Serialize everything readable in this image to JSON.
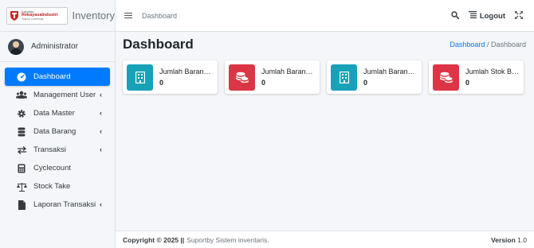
{
  "brand": {
    "line1": "Fakultas",
    "line2": "RekayasaIndustri",
    "line3": "Telkom University",
    "text": "Inventory"
  },
  "user": {
    "name": "Administrator"
  },
  "sidebar": {
    "items": [
      {
        "label": "Dashboard",
        "icon": "dashboard-icon"
      },
      {
        "label": "Management User",
        "icon": "users-icon"
      },
      {
        "label": "Data Master",
        "icon": "gear-icon"
      },
      {
        "label": "Data Barang",
        "icon": "database-icon"
      },
      {
        "label": "Transaksi",
        "icon": "exchange-icon"
      },
      {
        "label": "Cyclecount",
        "icon": "calculator-icon"
      },
      {
        "label": "Stock Take",
        "icon": "balance-icon"
      },
      {
        "label": "Laporan Transaksi",
        "icon": "file-icon"
      }
    ]
  },
  "topbar": {
    "title": "Dashboard",
    "logout": "Logout"
  },
  "page": {
    "title": "Dashboard",
    "breadcrumb": {
      "home": "Dashboard",
      "sep": "/",
      "current": "Dashboard"
    }
  },
  "boxes": [
    {
      "label": "Jumlah Barang...",
      "value": "0",
      "color": "#17a2b8",
      "icon": "building-icon"
    },
    {
      "label": "Jumlah Barang...",
      "value": "0",
      "color": "#dc3545",
      "icon": "coins-icon"
    },
    {
      "label": "Jumlah Barang...",
      "value": "0",
      "color": "#17a2b8",
      "icon": "building-icon"
    },
    {
      "label": "Jumlah Stok Ba...",
      "value": "0",
      "color": "#dc3545",
      "icon": "coins-icon"
    }
  ],
  "footer": {
    "copyright": "Copyright © 2025 ||",
    "tagline": "Suportby Sistem inventaris.",
    "version_label": "Version",
    "version": "1.0"
  }
}
